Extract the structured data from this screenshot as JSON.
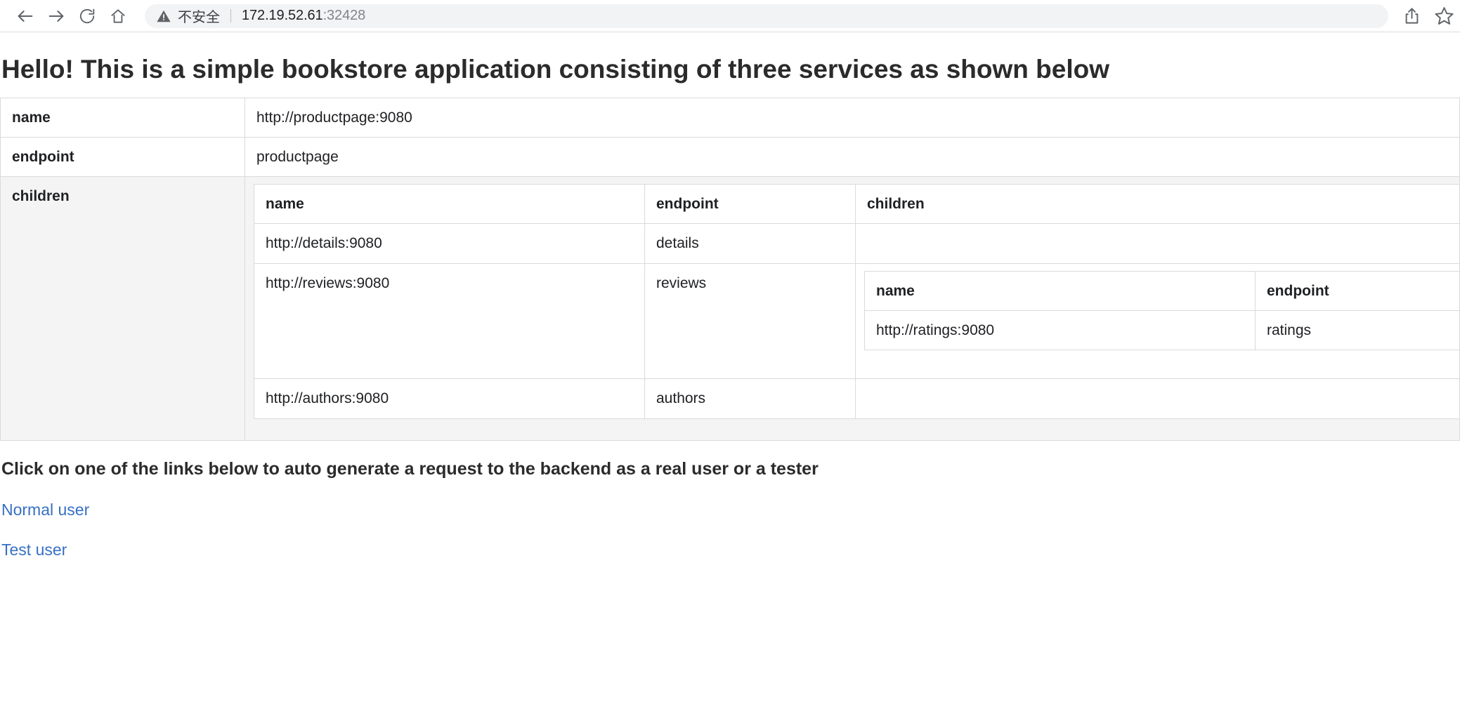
{
  "browser": {
    "nav": {
      "back": "back-arrow",
      "forward": "forward-arrow",
      "reload": "reload",
      "home": "home"
    },
    "omnibox": {
      "security_label": "不安全",
      "host": "172.19.52.61",
      "port": ":32428"
    },
    "actions": {
      "share": "share-icon",
      "bookmark": "star-icon"
    }
  },
  "page": {
    "heading": "Hello! This is a simple bookstore application consisting of three services as shown below",
    "instruction": "Click on one of the links below to auto generate a request to the backend as a real user or a tester",
    "links": [
      {
        "label": "Normal user"
      },
      {
        "label": "Test user"
      }
    ],
    "root": {
      "keys": {
        "name": "name",
        "endpoint": "endpoint",
        "children": "children"
      },
      "name": "http://productpage:9080",
      "endpoint": "productpage"
    },
    "level2": {
      "headers": [
        "name",
        "endpoint",
        "children"
      ],
      "rows": [
        {
          "name": "http://details:9080",
          "endpoint": "details"
        },
        {
          "name": "http://reviews:9080",
          "endpoint": "reviews"
        },
        {
          "name": "http://authors:9080",
          "endpoint": "authors"
        }
      ]
    },
    "level3": {
      "headers": [
        "name",
        "endpoint"
      ],
      "rows": [
        {
          "name": "http://ratings:9080",
          "endpoint": "ratings"
        }
      ]
    }
  }
}
